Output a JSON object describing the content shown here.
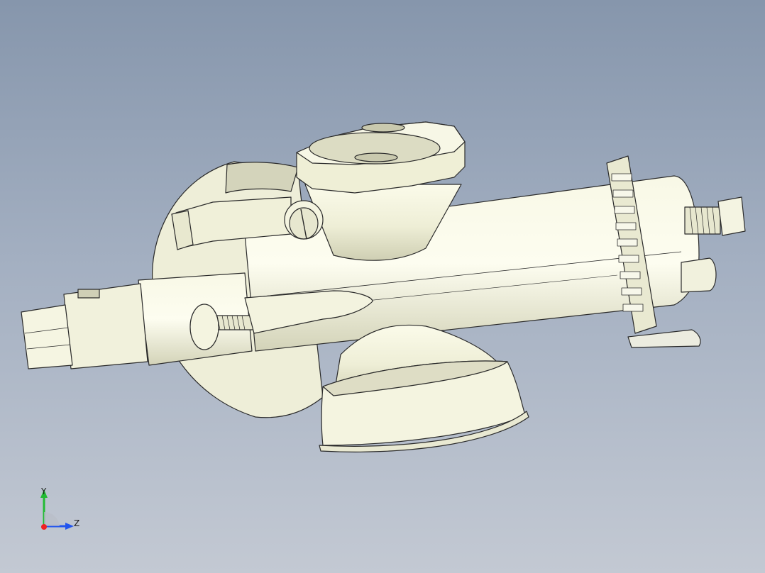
{
  "viewport": {
    "background_top": "#8696ac",
    "background_bottom": "#c3c9d3",
    "model_fill": "#f3f3dc",
    "model_shade": "#d9d9bd",
    "edge_color": "#2a2a2a"
  },
  "triad": {
    "y_label": "Y",
    "z_label": "Z",
    "y_color": "#22bb33",
    "z_color": "#2255ee",
    "x_color": "#ee2222"
  }
}
